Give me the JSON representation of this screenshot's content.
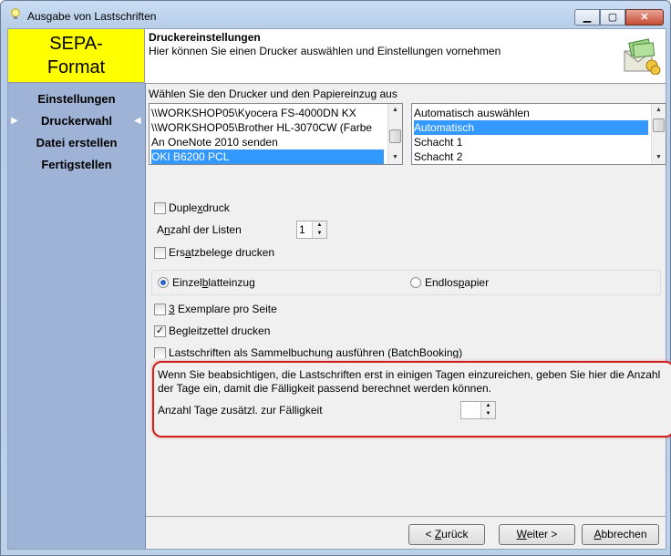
{
  "window": {
    "title": "Ausgabe von Lastschriften",
    "min_glyph": "▁",
    "max_glyph": "▢",
    "close_glyph": "✕"
  },
  "logo": {
    "line1": "SEPA-",
    "line2": "Format"
  },
  "header": {
    "title": "Druckereinstellungen",
    "subtitle": "Hier können Sie einen Drucker auswählen und Einstellungen vornehmen",
    "icon": "envelope-money-icon"
  },
  "sidebar": {
    "items": [
      {
        "label": "Einstellungen"
      },
      {
        "label": "Druckerwahl",
        "active": true
      },
      {
        "label": "Datei erstellen"
      },
      {
        "label": "Fertigstellen"
      }
    ]
  },
  "printer": {
    "label": "Wählen Sie den Drucker und den Papiereinzug aus",
    "printers": [
      "\\\\WORKSHOP05\\Kyocera FS-4000DN KX",
      "\\\\WORKSHOP05\\Brother HL-3070CW (Farbe",
      "An OneNote 2010 senden",
      "OKI B6200 PCL"
    ],
    "selected_printer_index": 3,
    "trays": [
      "Automatisch auswählen",
      "Automatisch",
      "Schacht 1",
      "Schacht 2"
    ],
    "selected_tray_index": 1
  },
  "options": {
    "duplex": {
      "pre": "Duple",
      "key": "x",
      "post": "druck",
      "checked": false
    },
    "lists_label_pre": "A",
    "lists_label_key": "n",
    "lists_label_post": "zahl der Listen",
    "lists_value": "1",
    "ersatz": {
      "pre": "Ers",
      "key": "a",
      "post": "tzbelege drucken",
      "checked": false
    },
    "radio_single": {
      "pre": "Einzel",
      "key": "b",
      "post": "latteinzug",
      "checked": true
    },
    "radio_endless": {
      "pre": "Endlos",
      "key": "p",
      "post": "apier",
      "checked": false
    },
    "three_copies": {
      "key": "3",
      "post": " Exemplare pro Seite",
      "checked": false
    },
    "begleit": {
      "pre": "Begleitzettel drucken",
      "checked": true
    },
    "sammel": {
      "label": "Lastschriften als Sammelbuchung ausführen (BatchBooking)",
      "checked": false
    }
  },
  "info": {
    "text": "Wenn Sie beabsichtigen, die Lastschriften erst in einigen Tagen einzureichen, geben Sie hier die Anzahl der Tage ein, damit die Fälligkeit passend berechnet werden können.",
    "days_label": "Anzahl Tage zusätzl. zur Fälligkeit",
    "days_value": ""
  },
  "buttons": {
    "back": {
      "pre": "< ",
      "key": "Z",
      "post": "urück"
    },
    "next": {
      "key": "W",
      "post": "eiter >"
    },
    "cancel": {
      "key": "A",
      "post": "bbrechen"
    }
  }
}
